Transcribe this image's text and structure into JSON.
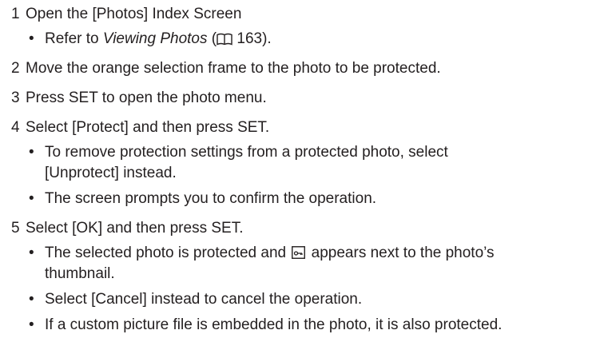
{
  "steps": [
    {
      "number": "1",
      "text": "Open the [Photos] Index Screen",
      "bullets": [
        {
          "ref_prefix": "Refer to ",
          "ref_title": "Viewing Photos",
          "ref_open": " (",
          "ref_page": " 163)."
        }
      ]
    },
    {
      "number": "2",
      "text": "Move the orange selection frame to the photo to be protected.",
      "bullets": []
    },
    {
      "number": "3",
      "text": "Press SET to open the photo menu.",
      "bullets": []
    },
    {
      "number": "4",
      "text": "Select [Protect] and then press SET.",
      "bullets": [
        {
          "text": "To remove protection settings from a protected photo, select [Unprotect] instead."
        },
        {
          "text": "The screen prompts you to confirm the operation."
        }
      ]
    },
    {
      "number": "5",
      "text": "Select [OK] and then press SET.",
      "bullets": [
        {
          "before": "The selected photo is protected and ",
          "after": " appears next to the photo’s thumbnail."
        },
        {
          "text": "Select [Cancel] instead to cancel the operation."
        },
        {
          "text": "If a custom picture file is embedded in the photo, it is also protected."
        }
      ]
    }
  ],
  "icons": {
    "reference": "book-icon",
    "protect": "lock-key-icon"
  }
}
